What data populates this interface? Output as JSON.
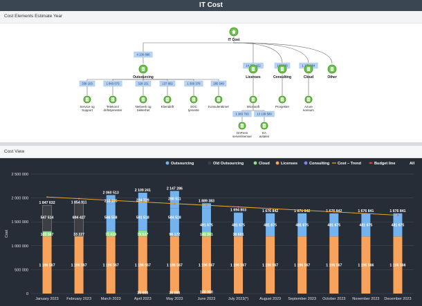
{
  "title": "IT Cost",
  "panel1_title": "Cost Elements Estimate Year",
  "panel2_title": "Cost View",
  "tree": {
    "root": "IT Cost",
    "categories": [
      {
        "name": "Outsourcing",
        "value": "4 136 896"
      },
      {
        "name": "Licenses",
        "value": "14 352 422"
      },
      {
        "name": "Consulting",
        "value": "160 636"
      },
      {
        "name": "Cloud",
        "value": "1 179 084"
      },
      {
        "name": "Other",
        "value": ""
      }
    ],
    "outsourcing_children": [
      {
        "name": "Service og Support",
        "value": "338 103"
      },
      {
        "name": "Telekom/ driftstjenester",
        "value": "1 843 073"
      },
      {
        "name": "Nettverk og Sikkerhet",
        "value": "328 151"
      },
      {
        "name": "Klientdrift",
        "value": "137 802"
      },
      {
        "name": "SOC tjeneste",
        "value": "1 300 378"
      },
      {
        "name": "Konsulenttimer",
        "value": "285 549"
      }
    ],
    "licenses_children": [
      {
        "name": "Microsoft",
        "value": ""
      }
    ],
    "microsoft_children": [
      {
        "name": "OnPrem serverlisenser",
        "value": "1 383 703"
      },
      {
        "name": "EA avtalen",
        "value": "13 138 580"
      }
    ],
    "consulting_children": [
      {
        "name": "Prosjekter",
        "value": ""
      }
    ],
    "cloud_children": [
      {
        "name": "Azure konsum",
        "value": ""
      }
    ]
  },
  "legend": [
    {
      "name": "Outsourcing",
      "color": "#74b3ee",
      "kind": "dot"
    },
    {
      "name": "Old Outsourcing",
      "color": "#3d3f44",
      "kind": "dot"
    },
    {
      "name": "Cloud",
      "color": "#93e383",
      "kind": "dot"
    },
    {
      "name": "Licenses",
      "color": "#f7a35c",
      "kind": "dot"
    },
    {
      "name": "Consulting",
      "color": "#8085e9",
      "kind": "dot"
    },
    {
      "name": "Cost – Trend",
      "color": "#e5b225",
      "kind": "line"
    },
    {
      "name": "Budget line",
      "color": "#e8453c",
      "kind": "marker"
    },
    {
      "name": "All",
      "color": "#ffffff",
      "kind": "text"
    }
  ],
  "chart_data": {
    "type": "bar",
    "stacked": true,
    "categories": [
      "January 2023",
      "February 2023",
      "March 2023",
      "April 2023",
      "May 2023",
      "June 2023",
      "July 2023(*)",
      "August 2023",
      "September 2023",
      "October 2023",
      "November 2023",
      "December 2023"
    ],
    "ylabel": "Cost",
    "ylim": [
      0,
      2500000
    ],
    "yticks": [
      "0",
      "500 000",
      "1 000 000",
      "1 500 000",
      "2 000 000",
      "2 500 000"
    ],
    "series": [
      {
        "name": "Licenses",
        "color": "#f7a35c",
        "values": [
          1196567,
          1196567,
          1196567,
          1196567,
          1196567,
          1196567,
          1196567,
          1196567,
          1196567,
          1196567,
          1196567,
          1196567
        ]
      },
      {
        "name": "Consulting",
        "color": "#8085e9",
        "values": [
          0,
          0,
          0,
          0,
          0,
          0,
          0,
          0,
          0,
          0,
          0,
          0
        ]
      },
      {
        "name": "Cloud",
        "color": "#93e383",
        "values": [
          103547,
          0,
          107000,
          119527,
          0,
          102057,
          0,
          0,
          0,
          0,
          0,
          0
        ]
      },
      {
        "name": "Old Outsourcing",
        "color": "#3d3f44",
        "values": [
          547518,
          694427,
          0,
          0,
          0,
          0,
          0,
          0,
          0,
          0,
          0,
          0
        ]
      },
      {
        "name": "Outsourcing",
        "color": "#74b3ee",
        "values": [
          0,
          0,
          566558,
          591518,
          584518,
          481675,
          481675,
          481675,
          481675,
          481675,
          481675,
          481675
        ]
      }
    ],
    "segment_labels": {
      "Licenses": [
        "1 196 567",
        "1 196 567",
        "1 196 567",
        "1 196 567",
        "1 196 567",
        "1 196 567",
        "1 196 567",
        "1 196 567",
        "1 196 567",
        "1 196 567",
        "1 196 566",
        "1 196 566"
      ],
      "Cloud": [
        "103 547",
        "33 227",
        "71 419",
        "79 527",
        "96 172",
        "141 241",
        "30 601",
        "",
        "",
        "",
        "",
        ""
      ],
      "Old Outsourcing": [
        "547 514",
        "694 427",
        "",
        "",
        "",
        "",
        "",
        "",
        "",
        "",
        "",
        ""
      ],
      "Outsourcing": [
        "",
        "",
        "566 558",
        "591 518",
        "584 518",
        "481 675",
        "481 675",
        "481 675",
        "481 675",
        "481 675",
        "481 675",
        "481 675"
      ]
    },
    "totals": [
      1847632,
      1854911,
      2060513,
      2109241,
      2147286,
      1889383,
      1694803,
      1676842,
      1676842,
      1676842,
      1676841,
      1676841
    ],
    "totals_labels": [
      "1 847 632",
      "1 854 911",
      "2 060 513",
      "2 109 241",
      "2 147 286",
      "1 889 383",
      "1 694 803",
      "1 676 842",
      "1 676 842",
      "1 676 842",
      "1 676 841",
      "1 676 841"
    ],
    "extra_labels": [
      {
        "index": 2,
        "value": "218 195"
      },
      {
        "index": 3,
        "value": "224 729"
      },
      {
        "index": 4,
        "value": "280 511"
      },
      {
        "index": 3,
        "value": "30 000"
      },
      {
        "index": 4,
        "value": "30 000"
      },
      {
        "index": 5,
        "value": "100 000"
      }
    ],
    "trend": {
      "name": "Cost – Trend",
      "start": 2020000,
      "end": 1640000
    },
    "budget": {
      "name": "Budget line",
      "start": 2020000,
      "end": 1640000
    }
  }
}
